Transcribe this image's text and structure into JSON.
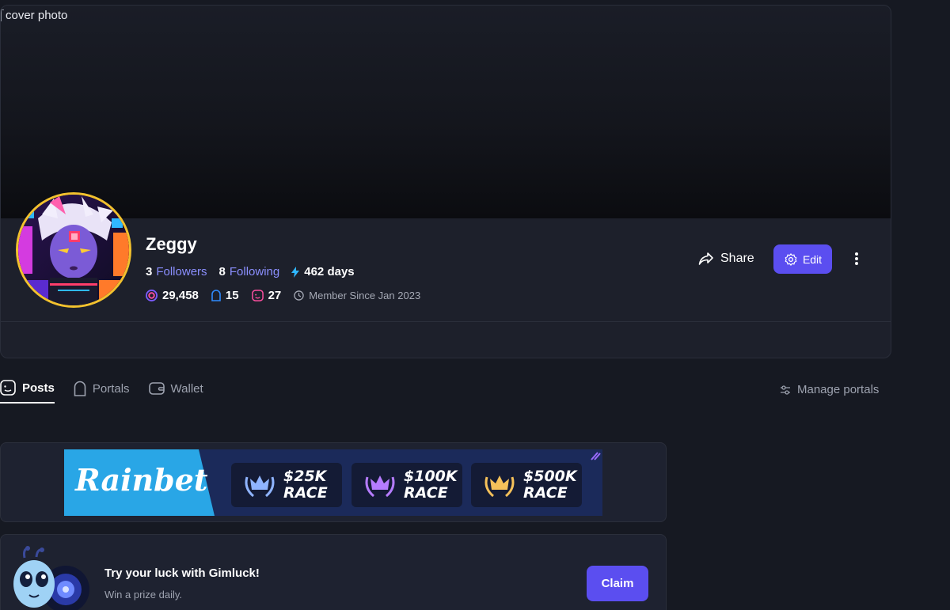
{
  "cover": {
    "alt_text": "cover photo"
  },
  "profile": {
    "username": "Zeggy",
    "followers_count": "3",
    "followers_label": "Followers",
    "following_count": "8",
    "following_label": "Following",
    "days_label": "462 days",
    "points": "29,458",
    "portals_count": "15",
    "posts_count": "27",
    "member_since": "Member Since Jan 2023"
  },
  "actions": {
    "share_label": "Share",
    "edit_label": "Edit"
  },
  "tabs": [
    {
      "label": "Posts",
      "active": true
    },
    {
      "label": "Portals",
      "active": false
    },
    {
      "label": "Wallet",
      "active": false
    }
  ],
  "manage_portals_label": "Manage portals",
  "banner": {
    "brand": "Rainbet",
    "races": [
      {
        "amount": "$25K",
        "label": "RACE",
        "color": "#8fb4ff"
      },
      {
        "amount": "$100K",
        "label": "RACE",
        "color": "#b57cff"
      },
      {
        "amount": "$500K",
        "label": "RACE",
        "color": "#f5c15a"
      }
    ]
  },
  "gimluck": {
    "title": "Try your luck with Gimluck!",
    "subtitle": "Win a prize daily.",
    "claim_label": "Claim"
  },
  "colors": {
    "accent": "#5b4ef0",
    "link": "#8b8fff",
    "avatar_ring": "#f2c12e",
    "background": "#161922",
    "card": "#1d202b"
  }
}
